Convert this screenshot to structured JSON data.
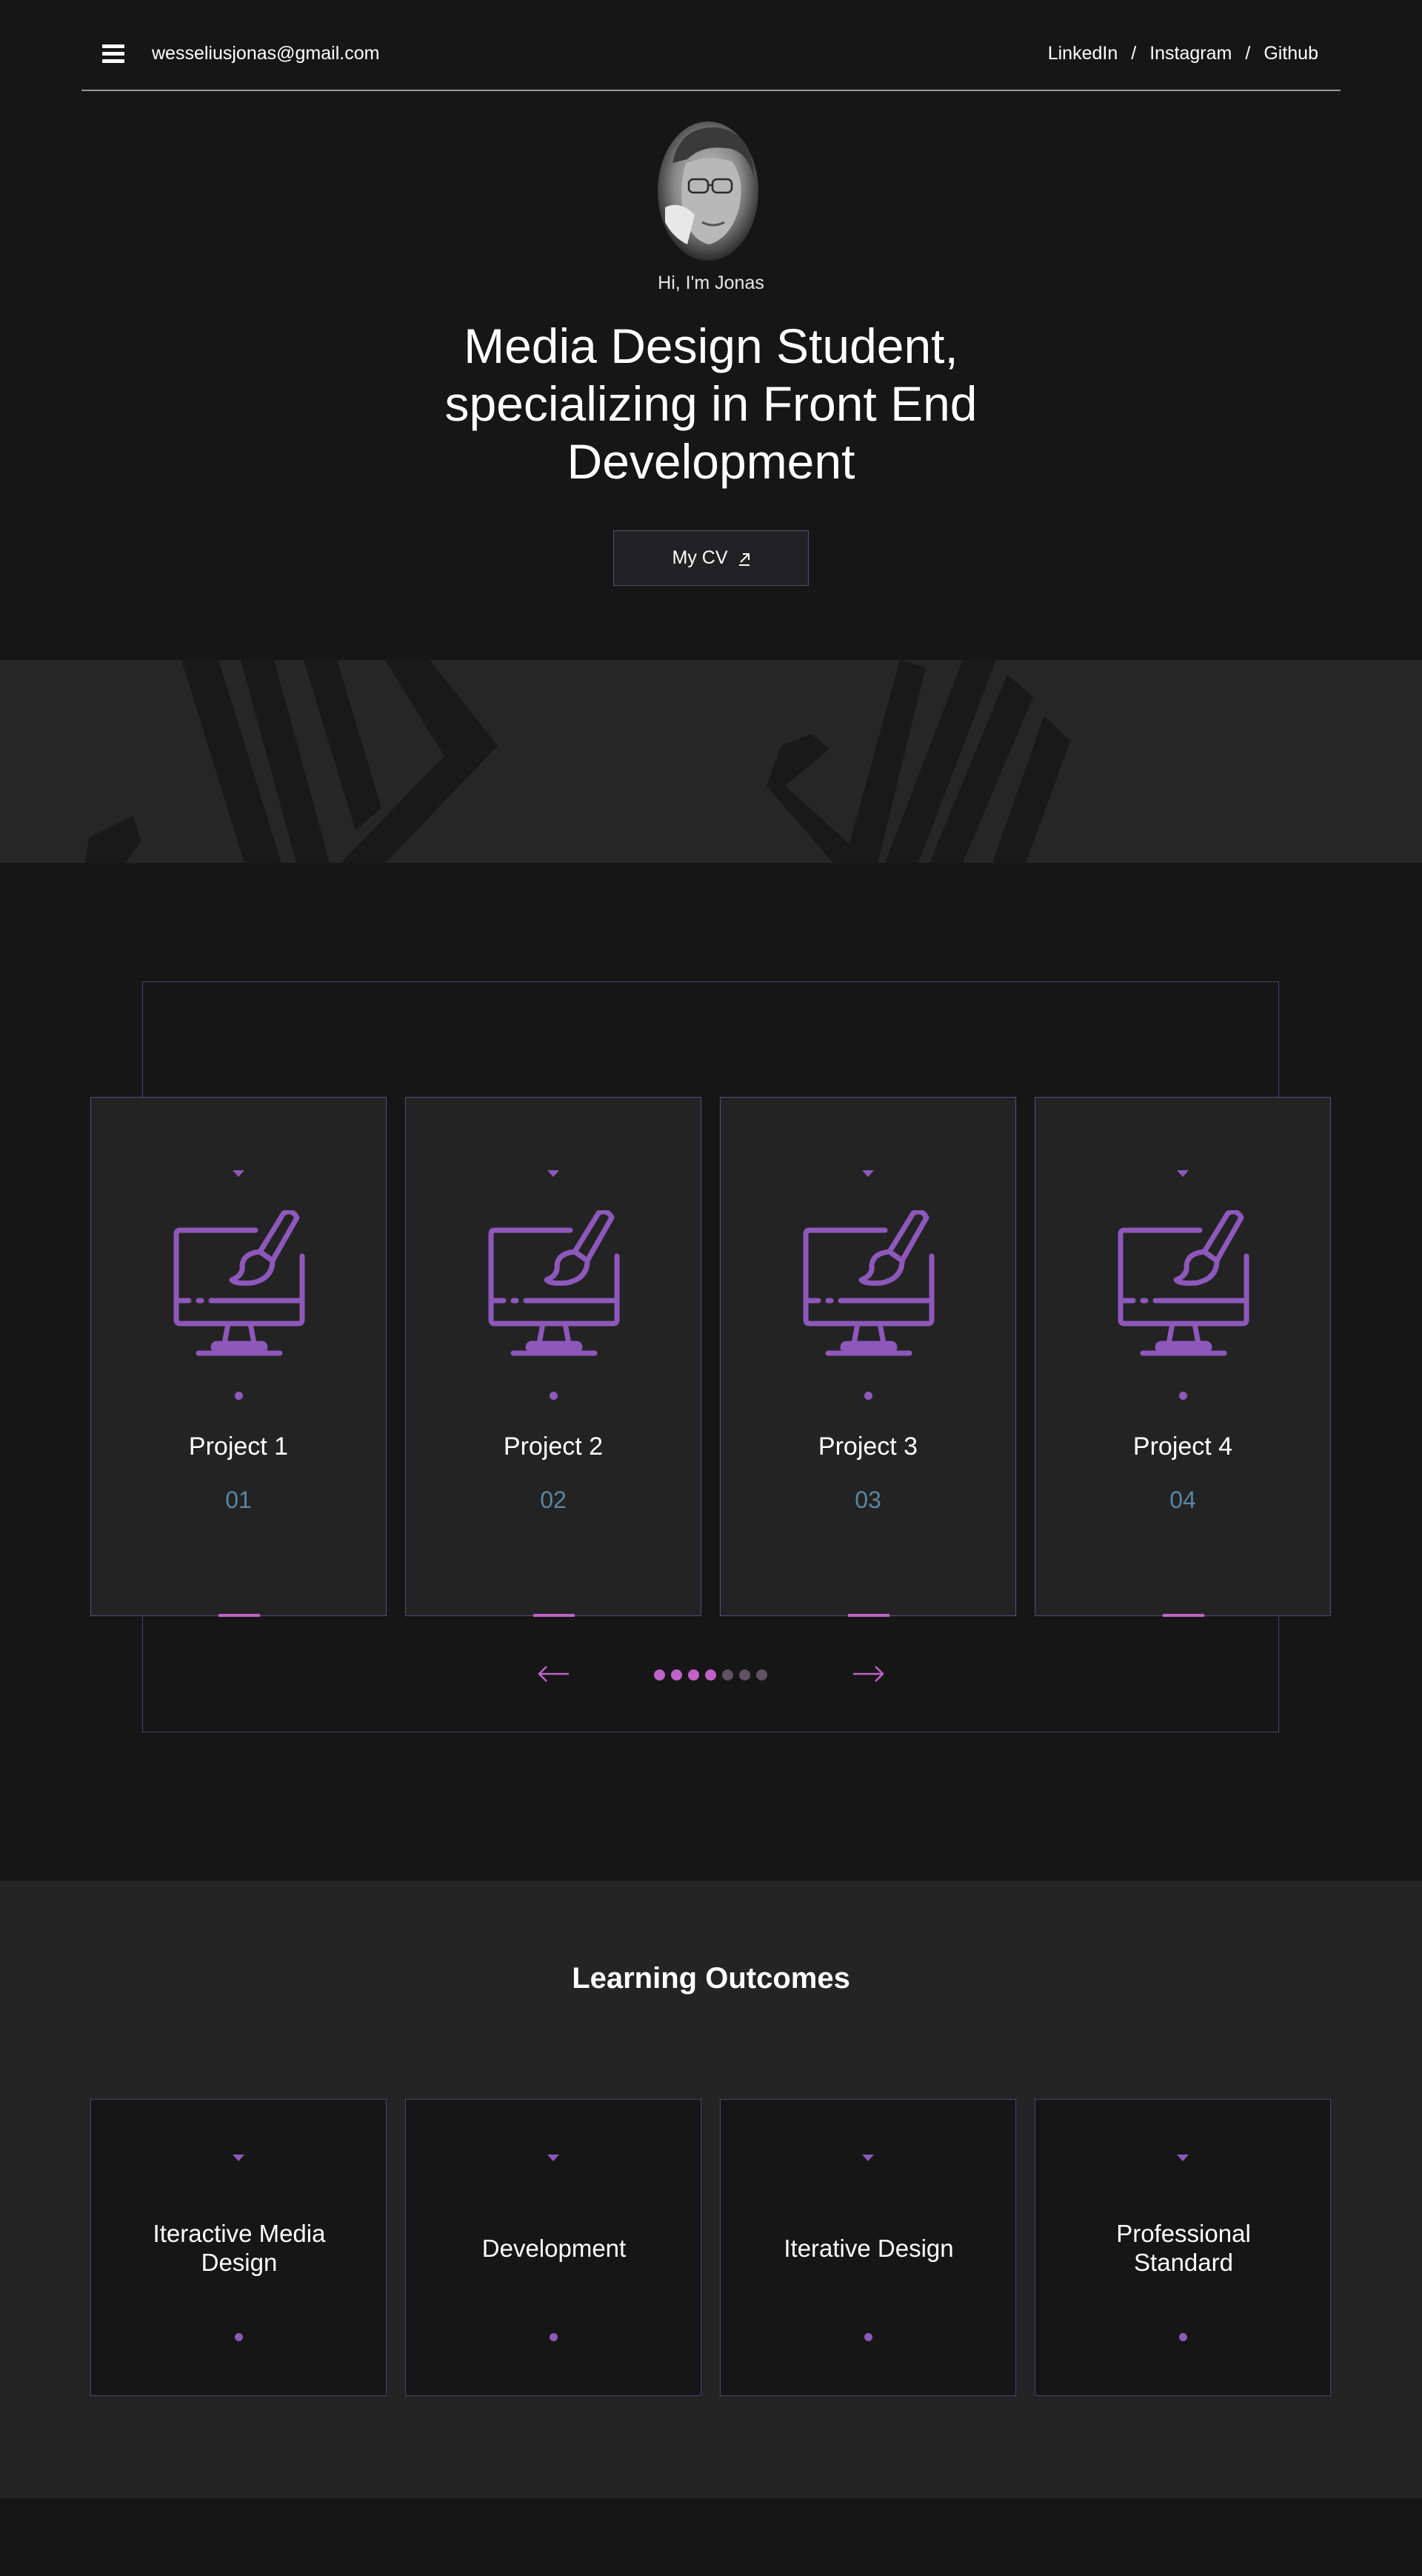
{
  "header": {
    "email": "wesseliusjonas@gmail.com",
    "socials": [
      "LinkedIn",
      "Instagram",
      "Github"
    ],
    "separator": "/"
  },
  "hero": {
    "greeting": "Hi, I'm Jonas",
    "headline": "Media Design Student, specializing in Front End Development",
    "cv_label": "My CV"
  },
  "projects": {
    "items": [
      {
        "title": "Project 1",
        "number": "01",
        "icon": "monitor-paintbrush-icon"
      },
      {
        "title": "Project 2",
        "number": "02",
        "icon": "monitor-paintbrush-icon"
      },
      {
        "title": "Project 3",
        "number": "03",
        "icon": "monitor-paintbrush-icon"
      },
      {
        "title": "Project 4",
        "number": "04",
        "icon": "monitor-paintbrush-icon"
      }
    ],
    "prev_icon": "arrow-left-icon",
    "next_icon": "arrow-right-icon",
    "pagination": {
      "total": 7,
      "active": 4
    }
  },
  "outcomes": {
    "title": "Learning Outcomes",
    "items": [
      {
        "label": "Iteractive Media Design"
      },
      {
        "label": "Development"
      },
      {
        "label": "Iterative Design"
      },
      {
        "label": "Professional Standard"
      }
    ]
  },
  "colors": {
    "background": "#161616",
    "panel": "#232324",
    "accent_purple": "#8e58bb",
    "accent_pink": "#c062c8",
    "number_blue": "#5b86a4",
    "border_purple": "#5a4a7e"
  }
}
